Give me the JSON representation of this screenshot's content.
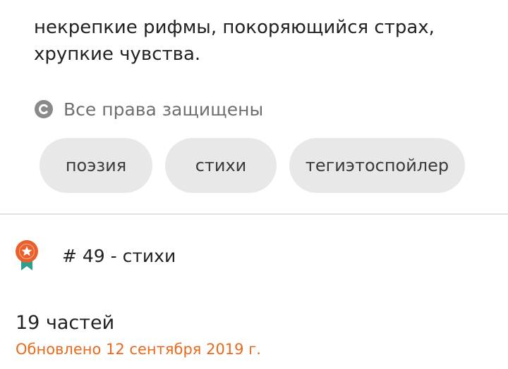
{
  "description": {
    "line1": "некрепкие рифмы, покоряющийся страх,",
    "line2": "хрупкие чувства."
  },
  "copyright": {
    "icon": "copyright-icon",
    "text": "Все права защищены"
  },
  "tags": [
    {
      "label": "поэзия"
    },
    {
      "label": "стихи"
    },
    {
      "label": "тегиэтоспойлер"
    }
  ],
  "ranking": {
    "icon": "award-badge-icon",
    "text": "# 49 - стихи",
    "badge_color": "#e8612c",
    "ribbon_color": "#2f9e8f"
  },
  "story_info": {
    "parts": "19 частей",
    "updated": "Обновлено 12 сентября 2019 г."
  },
  "colors": {
    "accent": "#e96a1d",
    "tag_bg": "#e8e8e8",
    "muted_text": "#6f6f6f"
  }
}
